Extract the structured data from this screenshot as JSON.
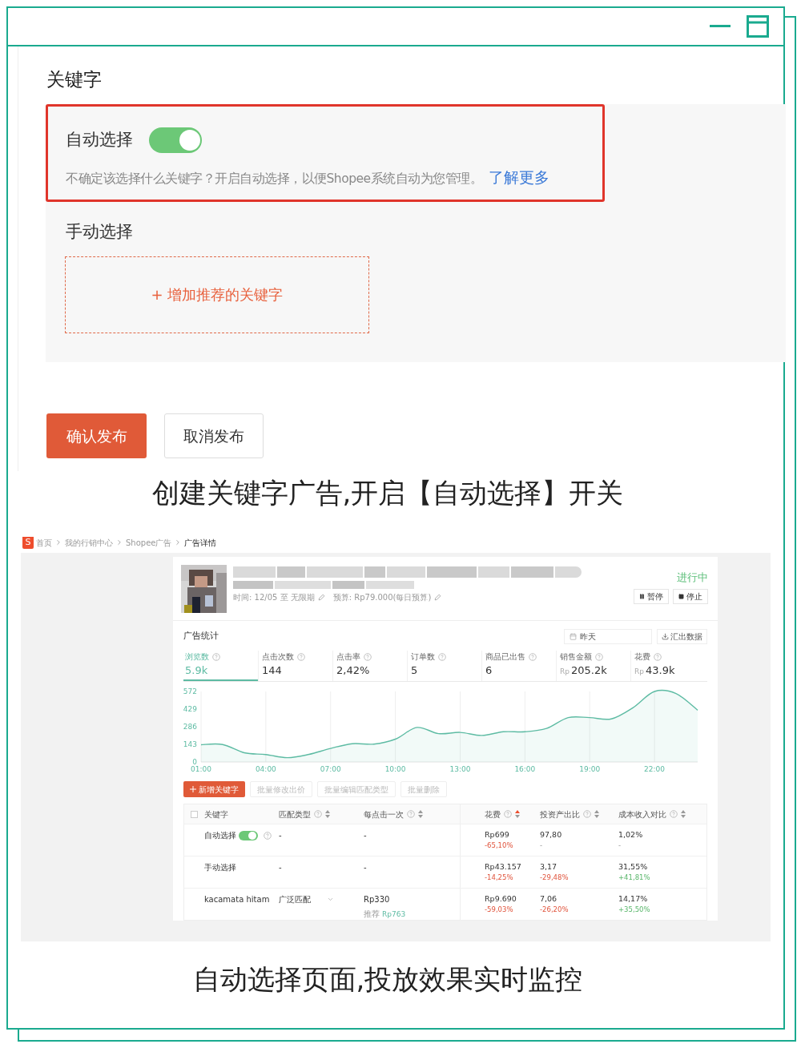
{
  "keyword_panel": {
    "title": "关键字",
    "auto": {
      "label": "自动选择",
      "on": true,
      "description": "不确定该选择什么关键字？开启自动选择，以便Shopee系统自动为您管理。",
      "link": "了解更多"
    },
    "manual": {
      "label": "手动选择",
      "add_button": "+ 增加推荐的关键字"
    },
    "buttons": [
      {
        "label": "确认发布",
        "kind": "primary"
      },
      {
        "label": "取消发布",
        "kind": "secondary"
      }
    ]
  },
  "caption_1": "创建关键字广告,开启【自动选择】开关",
  "dashboard": {
    "logo": "S",
    "breadcrumb": [
      {
        "label": "首页",
        "current": false
      },
      {
        "label": "我的行销中心",
        "current": false
      },
      {
        "label": "Shopee广告",
        "current": false
      },
      {
        "label": "广告详情",
        "current": true
      }
    ],
    "ad": {
      "period": "时间: 12/05 至 无限期",
      "budget": "预算: Rp79.000(每日预算)",
      "status": "进行中",
      "actions": [
        {
          "label": "暂停",
          "kind": "pause"
        },
        {
          "label": "停止",
          "kind": "stop"
        }
      ]
    },
    "stats": {
      "title": "广告统计",
      "date": "昨天",
      "export": "汇出数据",
      "metrics": [
        {
          "label": "浏览数",
          "value": "5.9k",
          "selected": true
        },
        {
          "label": "点击次数",
          "value": "144",
          "selected": false
        },
        {
          "label": "点击率",
          "value": "2,42%",
          "selected": false
        },
        {
          "label": "订单数",
          "value": "5",
          "selected": false
        },
        {
          "label": "商品已出售",
          "value": "6",
          "selected": false
        },
        {
          "label": "销售金额",
          "prefix": "Rp",
          "value": "205.2k",
          "selected": false
        },
        {
          "label": "花费",
          "prefix": "Rp",
          "value": "43.9k",
          "selected": false
        }
      ]
    },
    "chart_data": {
      "type": "area",
      "x": [
        1,
        2,
        3,
        4,
        5,
        6,
        7,
        8,
        9,
        10,
        11,
        12,
        13,
        14,
        15,
        16,
        17,
        18,
        19,
        20,
        21,
        22,
        23,
        24
      ],
      "xlim": [
        1,
        24
      ],
      "grid": true,
      "series": [
        {
          "color": "#5dbba3",
          "values": [
            140,
            142,
            75,
            60,
            35,
            62,
            110,
            148,
            145,
            185,
            280,
            230,
            240,
            215,
            245,
            245,
            272,
            360,
            360,
            350,
            440,
            572,
            555,
            420
          ]
        }
      ],
      "ylim": [
        0,
        572
      ],
      "yticks": [
        0,
        143,
        286,
        429,
        572
      ],
      "xticks": [
        {
          "value": 1,
          "label": "01:00"
        },
        {
          "value": 4,
          "label": "04:00"
        },
        {
          "value": 7,
          "label": "07:00"
        },
        {
          "value": 10,
          "label": "10:00"
        },
        {
          "value": 13,
          "label": "13:00"
        },
        {
          "value": 16,
          "label": "16:00"
        },
        {
          "value": 19,
          "label": "19:00"
        },
        {
          "value": 22,
          "label": "22:00"
        }
      ]
    },
    "toolbar": [
      {
        "label": "新增关键字",
        "kind": "add",
        "disabled": false
      },
      {
        "label": "批量修改出价",
        "kind": "plain",
        "disabled": true
      },
      {
        "label": "批量编辑匹配类型",
        "kind": "plain",
        "disabled": true
      },
      {
        "label": "批量删除",
        "kind": "plain",
        "disabled": true
      }
    ],
    "table": {
      "select_all_checked": false,
      "columns": [
        {
          "label": "关键字",
          "help": false,
          "sort": false
        },
        {
          "label": "匹配类型",
          "help": true,
          "sort": true,
          "sorted": false
        },
        {
          "label": "每点击一次",
          "help": true,
          "sort": true,
          "sorted": false
        },
        {
          "label": "花费",
          "help": true,
          "sort": true,
          "sorted": true
        },
        {
          "label": "投资产出比",
          "help": true,
          "sort": true,
          "sorted": false
        },
        {
          "label": "成本收入对比",
          "help": true,
          "sort": true,
          "sorted": false
        }
      ],
      "rows": [
        {
          "keyword": "自动选择",
          "toggle": {
            "on": true
          },
          "match": "-",
          "match_dropdown": false,
          "bid": "-",
          "spend": {
            "value": "Rp699",
            "change": "-65,10%",
            "kind": "down"
          },
          "roas": {
            "value": "97,80",
            "change": "-",
            "kind": "none"
          },
          "acos": {
            "value": "1,02%",
            "change": "-",
            "kind": "none"
          }
        },
        {
          "keyword": "手动选择",
          "match": "-",
          "match_dropdown": false,
          "bid": "-",
          "spend": {
            "value": "Rp43.157",
            "change": "-14,25%",
            "kind": "down"
          },
          "roas": {
            "value": "3,17",
            "change": "-29,48%",
            "kind": "down"
          },
          "acos": {
            "value": "31,55%",
            "change": "+41,81%",
            "kind": "up"
          }
        },
        {
          "keyword": "kacamata hitam",
          "match": "广泛匹配",
          "match_dropdown": true,
          "bid": "Rp330",
          "suggest_label": "推荐",
          "suggest_value": "Rp763",
          "spend": {
            "value": "Rp9.690",
            "change": "-59,03%",
            "kind": "down"
          },
          "roas": {
            "value": "7,06",
            "change": "-26,20%",
            "kind": "down"
          },
          "acos": {
            "value": "14,17%",
            "change": "+35,50%",
            "kind": "up"
          }
        }
      ]
    }
  },
  "caption_2": "自动选择页面,投放效果实时监控"
}
